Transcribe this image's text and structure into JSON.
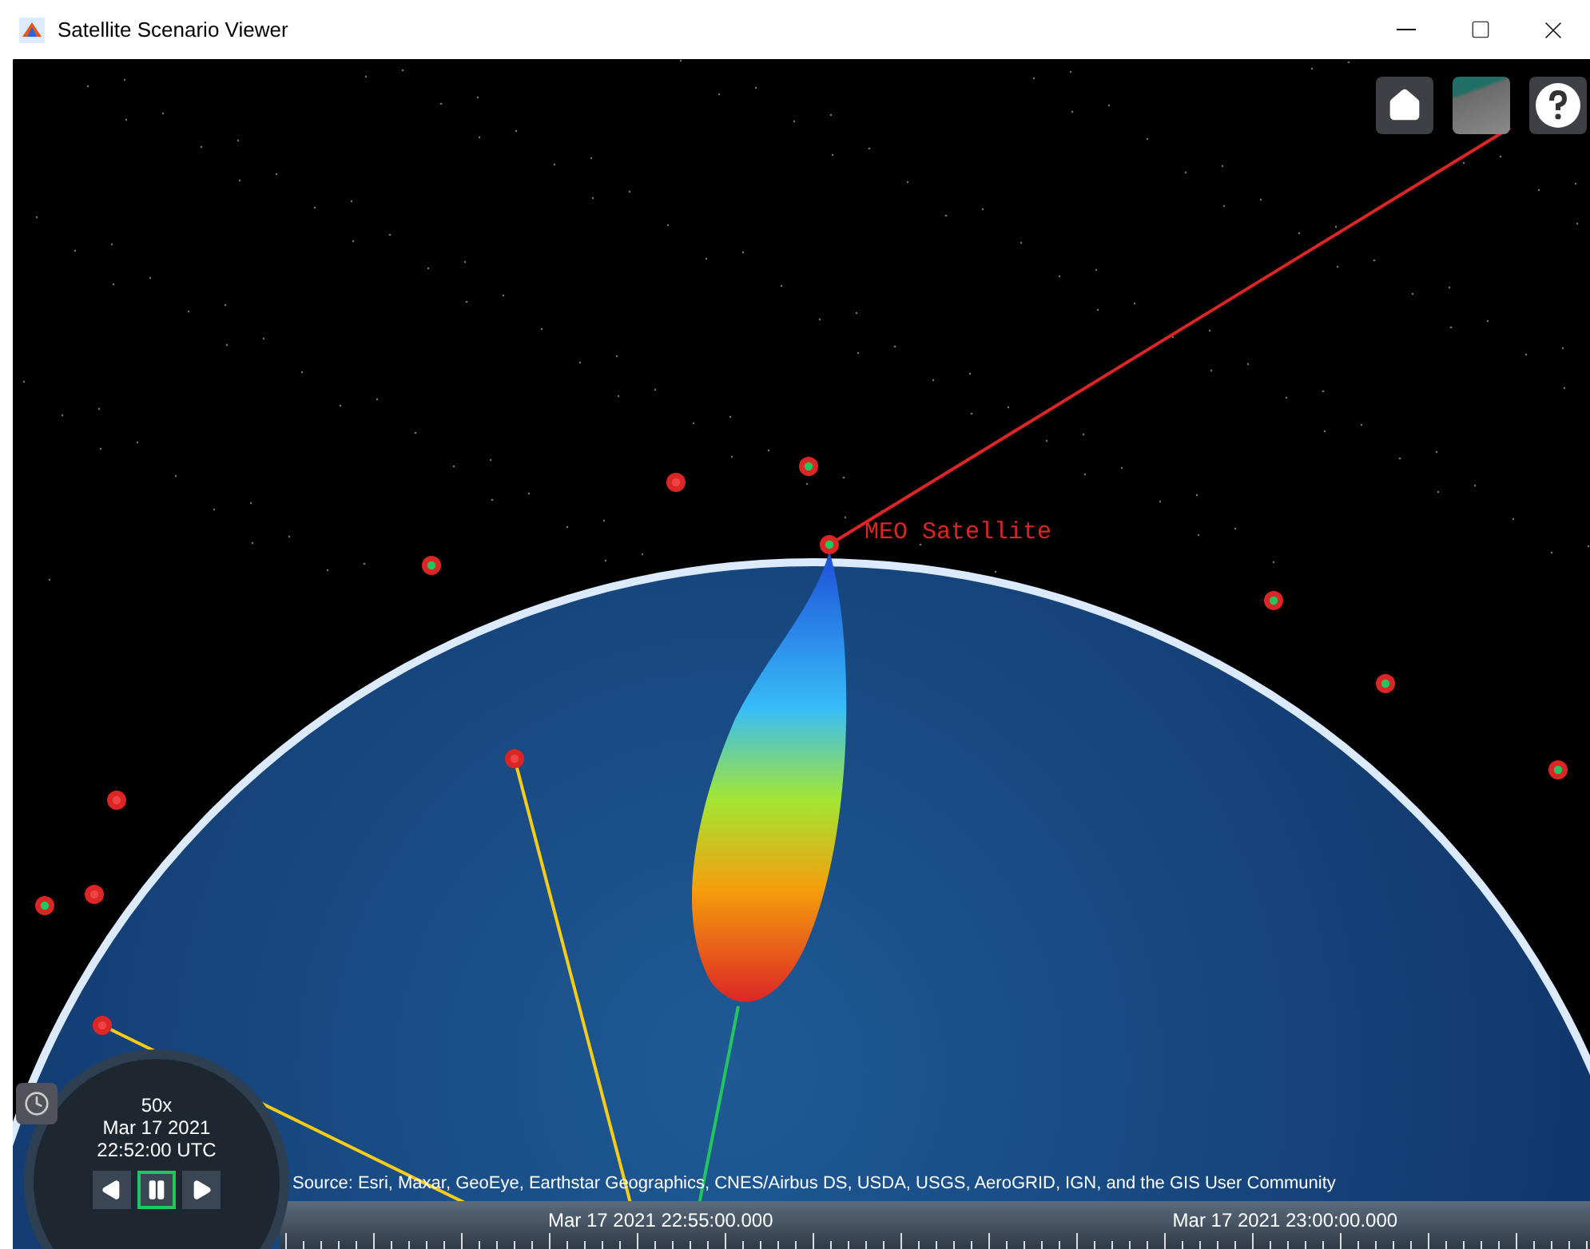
{
  "window": {
    "title": "Satellite Scenario Viewer"
  },
  "scene": {
    "satellite_label": "MEO Satellite",
    "markers": [
      {
        "color": "#22c55e"
      },
      {
        "color": "#22c55e"
      },
      {
        "color": "#22c55e"
      },
      {
        "color": "#22c55e"
      },
      {
        "color": "#22c55e"
      },
      {
        "color": "#22c55e"
      },
      {
        "color": "#22c55e"
      },
      {
        "color": "#ef4444"
      },
      {
        "color": "#ef4444"
      },
      {
        "color": "#ef4444"
      },
      {
        "color": "#ef4444"
      },
      {
        "color": "#ef4444"
      }
    ],
    "attribution": "Source: Esri, Maxar, GeoEye, Earthstar Geographics, CNES/Airbus DS, USDA, USGS, AeroGRID, IGN, and the GIS User Community"
  },
  "clock": {
    "speed": "50x",
    "date": "Mar 17 2021",
    "time": "22:52:00 UTC"
  },
  "timeline": {
    "labels": [
      "Mar 17 2021 22:55:00.000",
      "Mar 17 2021 23:00:00.000"
    ]
  }
}
